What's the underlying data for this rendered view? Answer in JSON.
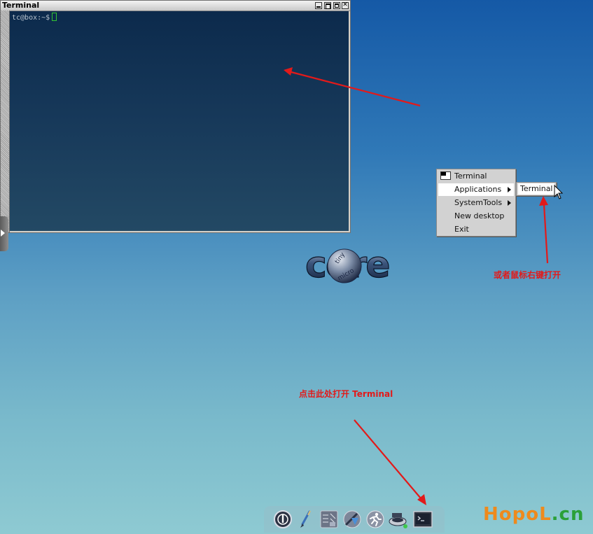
{
  "terminal_window": {
    "title": "Terminal",
    "prompt": "tc@box:~$"
  },
  "logo": {
    "main": "core",
    "small_top": "tiny",
    "small_bottom": "micro"
  },
  "context_menu": {
    "items": [
      {
        "label": "Terminal",
        "icon": "terminal-icon",
        "submenu": false,
        "highlighted": false
      },
      {
        "label": "Applications",
        "submenu": true,
        "highlighted": true
      },
      {
        "label": "SystemTools",
        "submenu": true,
        "highlighted": false
      },
      {
        "label": "New desktop",
        "submenu": false,
        "highlighted": false
      },
      {
        "label": "Exit",
        "submenu": false,
        "highlighted": false
      }
    ],
    "submenu": {
      "items": [
        {
          "label": "Terminal"
        }
      ]
    }
  },
  "annotations": {
    "right_click_note": "或者鼠标右键打开",
    "click_here_note": "点击此处打开 Terminal",
    "color": "#e21a1a"
  },
  "dock": {
    "icons": [
      {
        "name": "power-icon"
      },
      {
        "name": "paintbrush-icon"
      },
      {
        "name": "control-panel-icon"
      },
      {
        "name": "app-installer-icon"
      },
      {
        "name": "run-icon"
      },
      {
        "name": "mount-tool-icon"
      },
      {
        "name": "terminal-icon"
      }
    ]
  },
  "watermark": {
    "main": "HopoL",
    "tld": ".cn"
  },
  "colors": {
    "desktop_top": "#1559a6",
    "desktop_bottom": "#8ecad2",
    "menu_bg": "#d2d2d2",
    "watermark_orange": "#ee8a1c",
    "watermark_green": "#2aa039"
  }
}
